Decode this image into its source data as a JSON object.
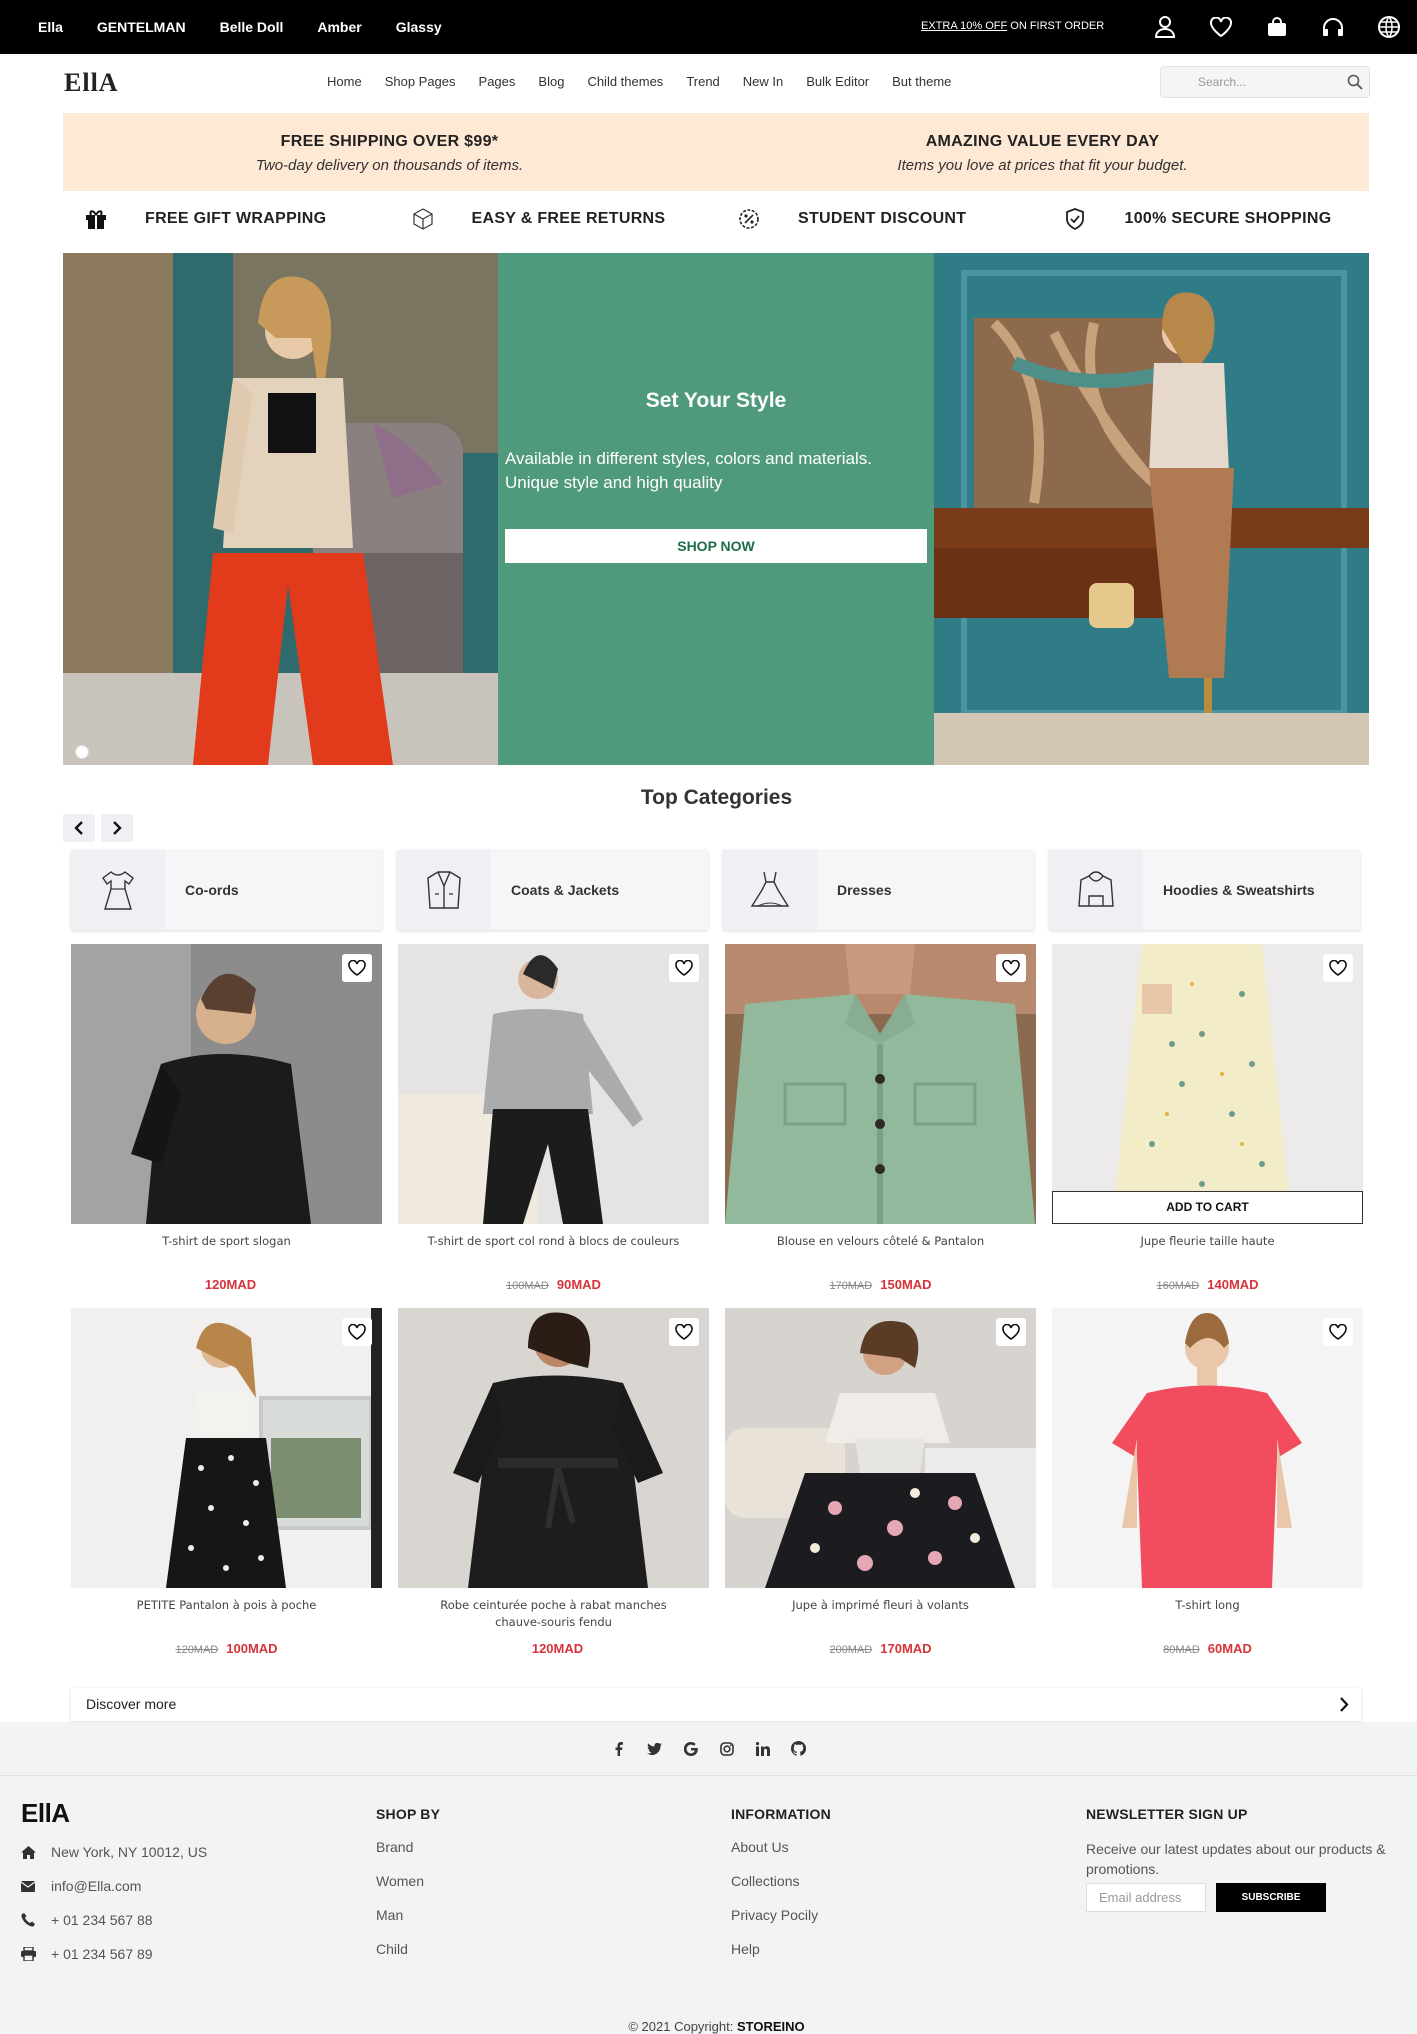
{
  "topbar": {
    "themes": [
      "Ella",
      "GENTELMAN",
      "Belle Doll",
      "Amber",
      "Glassy"
    ],
    "promo_link": "EXTRA 10% OFF",
    "promo_rest": " ON FIRST ORDER",
    "icons": [
      "user-icon",
      "heart-icon",
      "bag-icon",
      "headphones-icon",
      "globe-icon"
    ]
  },
  "header": {
    "logo": "EllA",
    "menu": [
      "Home",
      "Shop Pages",
      "Pages",
      "Blog",
      "Child themes",
      "Trend",
      "New In",
      "Bulk Editor",
      "But theme"
    ],
    "search_placeholder": "Search..."
  },
  "promos": [
    {
      "title": "FREE SHIPPING OVER $99*",
      "subtitle": "Two-day delivery on thousands of items."
    },
    {
      "title": "AMAZING VALUE EVERY DAY",
      "subtitle": "Items you love at prices that fit your budget."
    }
  ],
  "features": [
    {
      "icon": "gift-icon",
      "label": "FREE GIFT WRAPPING"
    },
    {
      "icon": "box-icon",
      "label": "EASY & FREE RETURNS"
    },
    {
      "icon": "discount-icon",
      "label": "STUDENT DISCOUNT"
    },
    {
      "icon": "shield-icon",
      "label": "100% SECURE SHOPPING"
    }
  ],
  "hero": {
    "title": "Set Your Style",
    "text": "Available in different styles, colors and materials. Unique style and high quality",
    "button": "SHOP NOW",
    "accent": "#4f9a7c"
  },
  "categories": {
    "title": "Top Categories",
    "items": [
      {
        "icon": "dress-set-icon",
        "label": "Co-ords"
      },
      {
        "icon": "jacket-icon",
        "label": "Coats & Jackets"
      },
      {
        "icon": "dress-icon",
        "label": "Dresses"
      },
      {
        "icon": "hoodie-icon",
        "label": "Hoodies & Sweatshirts"
      }
    ]
  },
  "products": [
    {
      "name": "T-shirt de sport slogan",
      "old": "",
      "price": "120MAD"
    },
    {
      "name": "T-shirt de sport col rond à blocs de couleurs",
      "old": "100MAD",
      "price": "90MAD"
    },
    {
      "name": "Blouse en velours côtelé & Pantalon",
      "old": "170MAD",
      "price": "150MAD"
    },
    {
      "name": "Jupe fleurie taille haute",
      "old": "160MAD",
      "price": "140MAD",
      "cta": "ADD TO CART"
    },
    {
      "name": "PETITE Pantalon à pois à poche",
      "old": "120MAD",
      "price": "100MAD"
    },
    {
      "name": "Robe ceinturée poche à rabat manches chauve-souris fendu",
      "old": "",
      "price": "120MAD"
    },
    {
      "name": "Jupe à imprimé fleuri à volants",
      "old": "200MAD",
      "price": "170MAD"
    },
    {
      "name": "T-shirt long",
      "old": "80MAD",
      "price": "60MAD"
    }
  ],
  "discover": "Discover more",
  "footer": {
    "social": [
      "facebook-icon",
      "twitter-icon",
      "google-icon",
      "instagram-icon",
      "linkedin-icon",
      "github-icon"
    ],
    "logo": "EllA",
    "contact": [
      {
        "icon": "home-icon",
        "text": "New York, NY 10012, US"
      },
      {
        "icon": "mail-icon",
        "text": "info@Ella.com"
      },
      {
        "icon": "phone-icon",
        "text": "+ 01 234 567 88"
      },
      {
        "icon": "print-icon",
        "text": "+ 01 234 567 89"
      }
    ],
    "shop_by": {
      "title": "SHOP BY",
      "items": [
        "Brand",
        "Women",
        "Man",
        "Child"
      ]
    },
    "information": {
      "title": "INFORMATION",
      "items": [
        "About Us",
        "Collections",
        "Privacy Pocily",
        "Help"
      ]
    },
    "newsletter": {
      "title": "NEWSLETTER SIGN UP",
      "text": "Receive our latest updates about our products & promotions.",
      "placeholder": "Email address",
      "button": "SUBSCRIBE"
    },
    "copyright_prefix": "© 2021 Copyright: ",
    "copyright_brand": "STOREINO"
  }
}
